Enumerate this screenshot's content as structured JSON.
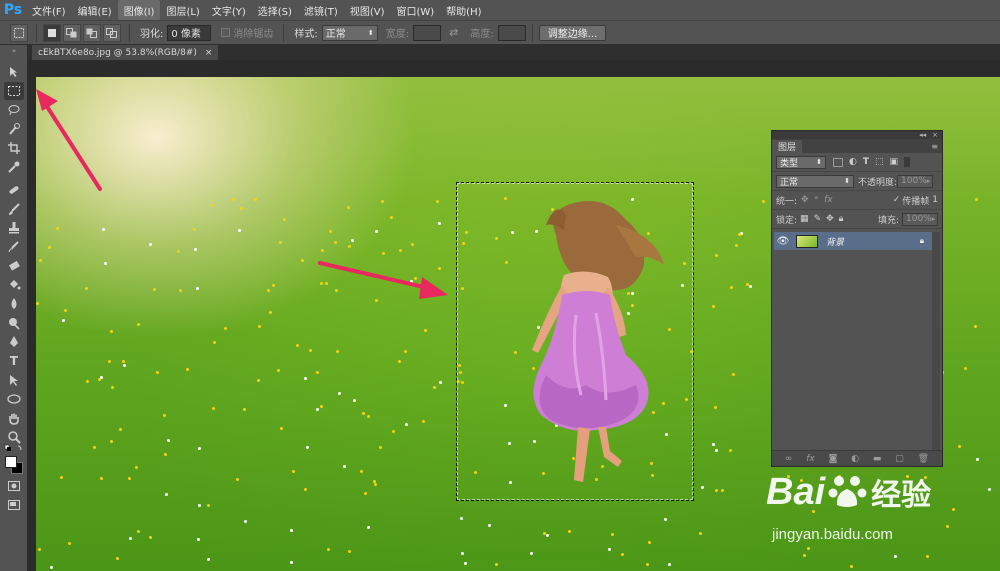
{
  "app": {
    "logo": "Ps"
  },
  "menu": [
    {
      "label": "文件(F)",
      "active": false
    },
    {
      "label": "编辑(E)",
      "active": false
    },
    {
      "label": "图像(I)",
      "active": true
    },
    {
      "label": "图层(L)",
      "active": false
    },
    {
      "label": "文字(Y)",
      "active": false
    },
    {
      "label": "选择(S)",
      "active": false
    },
    {
      "label": "滤镜(T)",
      "active": false
    },
    {
      "label": "视图(V)",
      "active": false
    },
    {
      "label": "窗口(W)",
      "active": false
    },
    {
      "label": "帮助(H)",
      "active": false
    }
  ],
  "options": {
    "feather_label": "羽化:",
    "feather_value": "0 像素",
    "antialias_label": "消除锯齿",
    "style_label": "样式:",
    "style_value": "正常",
    "width_label": "宽度:",
    "height_label": "高度:",
    "refine_edge_button": "调整边缘..."
  },
  "document": {
    "tab_title": "cEkBTX6e8o.jpg @ 53.8%(RGB/8#)",
    "close_glyph": "×"
  },
  "layers_panel": {
    "tab_label": "图层",
    "filter_kind": "类型",
    "blend_mode": "正常",
    "opacity_label": "不透明度:",
    "opacity_value": "100%",
    "unify_label": "统一:",
    "propagate_label": "传播帧",
    "propagate_value": "1",
    "lock_label": "锁定:",
    "fill_label": "填充:",
    "fill_value": "100%",
    "layers": [
      {
        "name": "背景",
        "visible": true,
        "locked": true
      }
    ]
  },
  "watermark": {
    "brand": "Bai",
    "brand_suffix": "经验",
    "url": "jingyan.baidu.com"
  },
  "colors": {
    "ui_dark": "#535353",
    "selected_layer": "#5b6e89",
    "arrow": "#e8285e",
    "ps_blue": "#31a8ff"
  }
}
